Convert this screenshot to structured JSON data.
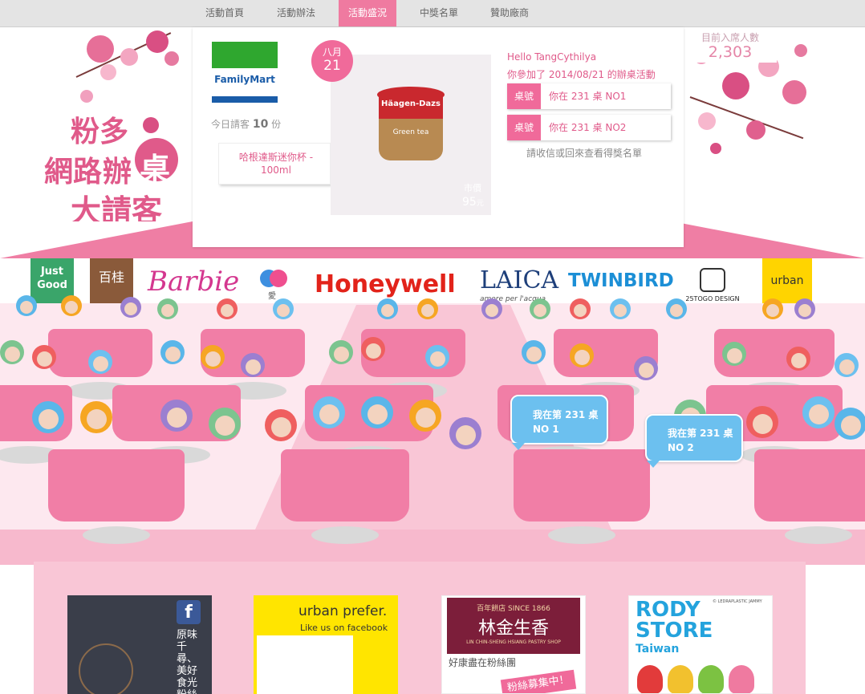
{
  "nav": {
    "items": [
      {
        "label": "活動首頁"
      },
      {
        "label": "活動辦法"
      },
      {
        "label": "活動盛況"
      },
      {
        "label": "中獎名單"
      },
      {
        "label": "贊助廠商"
      }
    ],
    "active_index": 2
  },
  "logo": {
    "line1": "粉多",
    "line2a": "網路",
    "line2b": "辦",
    "line2c": "桌",
    "line3": "大請客"
  },
  "attendance": {
    "label": "目前入席人數",
    "value": "2,303"
  },
  "event": {
    "sponsor_logo": "FamilyMart",
    "treat_label": "今日請客",
    "treat_count": "10",
    "treat_unit": "份",
    "prize_name": "哈根達斯迷你杯 - 100ml",
    "date_month": "八月",
    "date_day": "21",
    "product_brand": "Häagen-Dazs",
    "product_flavor": "Green tea",
    "price_label": "市價",
    "price_value": "95",
    "price_unit": "元"
  },
  "user": {
    "greeting": "Hello TangCythilya",
    "joined": "你參加了 2014/08/21 的辦桌活動",
    "seats": [
      {
        "tag": "桌號",
        "text": "你在 231 桌 NO1"
      },
      {
        "tag": "桌號",
        "text": "你在 231 桌 NO2"
      }
    ],
    "notice": "請收信或回來查看得獎名單"
  },
  "sponsors": [
    {
      "name": "Just Good",
      "line1": "Just",
      "line2": "Good"
    },
    {
      "name": "百桂",
      "label": "百桂"
    },
    {
      "name": "Barbie",
      "label": "Barbie"
    },
    {
      "name": "愛",
      "label": "愛"
    },
    {
      "name": "Honeywell",
      "label": "Honeywell"
    },
    {
      "name": "LAICA",
      "label": "LAICA",
      "sub": "amore per l'acqua"
    },
    {
      "name": "TWINBIRD",
      "label": "TWINBIRD"
    },
    {
      "name": "25TOGO DESIGN",
      "label": "25TOGO DESIGN"
    },
    {
      "name": "urban",
      "label": "urban"
    }
  ],
  "bubbles": [
    {
      "line1": "我在第 231 桌",
      "line2": "NO 1"
    },
    {
      "line1": "我在第 231 桌",
      "line2": "NO 2"
    }
  ],
  "tiles": [
    {
      "text": "原味千尋、美好食光粉絲"
    },
    {
      "title": "urban prefer.",
      "sub": "Like us on facebook"
    },
    {
      "top": "百年餅店 SINCE 1866",
      "brand": "林金生香",
      "en": "LIN CHIN-SHENG HSIANG PASTRY SHOP",
      "caption": "好康盡在粉絲團",
      "promo": "粉絲募集中！"
    },
    {
      "title": "RODY",
      "title2": "STORE",
      "sub": "Taiwan",
      "corner": "© LEDRAPLASTIC JAMMY"
    }
  ],
  "colors": {
    "pink": "#ef7aa0",
    "blue": "#6cc0ef",
    "green": "#2fa72f",
    "navy": "#1a5ca8"
  }
}
